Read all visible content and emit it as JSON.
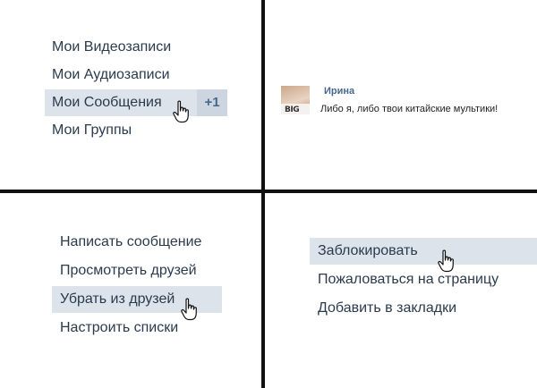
{
  "panel1": {
    "items": [
      {
        "label": "Мои Видеозаписи"
      },
      {
        "label": "Мои Аудиозаписи"
      },
      {
        "label": "Мои Сообщения",
        "badge": "+1"
      },
      {
        "label": "Мои Группы"
      }
    ]
  },
  "panel2": {
    "sender": "Ирина",
    "message": "Либо я, либо твои китайские мультики!",
    "avatar_shirt_text": "BIG"
  },
  "panel3": {
    "items": [
      {
        "label": "Написать сообщение"
      },
      {
        "label": "Просмотреть друзей"
      },
      {
        "label": "Убрать из друзей"
      },
      {
        "label": "Настроить списки"
      }
    ]
  },
  "panel4": {
    "items": [
      {
        "label": "Заблокировать"
      },
      {
        "label": "Пожаловаться на страницу"
      },
      {
        "label": "Добавить в закладки"
      }
    ]
  },
  "colors": {
    "text": "#2b3b4d",
    "highlight": "#dde3eb",
    "badge_bg": "#cdd6e0",
    "link": "#45688e",
    "divider": "#111111"
  },
  "icons": {
    "cursor": "hand-pointer-icon"
  }
}
